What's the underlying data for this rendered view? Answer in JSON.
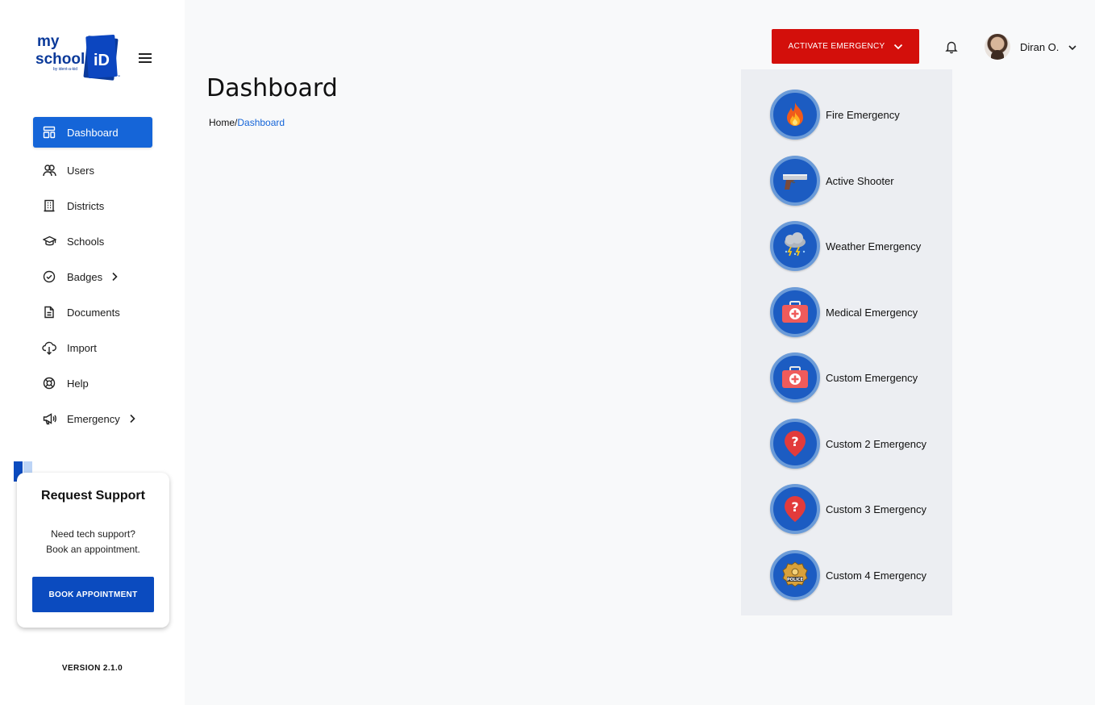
{
  "logo": {
    "line1": "my",
    "line2": "school",
    "mark": "iD",
    "tagline": "by ident-a-kid",
    "tm": "™"
  },
  "sidebar": {
    "items": [
      {
        "label": "Dashboard",
        "icon": "dashboard-icon",
        "active": true
      },
      {
        "label": "Users",
        "icon": "users-icon"
      },
      {
        "label": "Districts",
        "icon": "building-icon"
      },
      {
        "label": "Schools",
        "icon": "graduation-cap-icon"
      },
      {
        "label": "Badges",
        "icon": "check-circle-icon",
        "has_submenu": true
      },
      {
        "label": "Documents",
        "icon": "document-icon"
      },
      {
        "label": "Import",
        "icon": "cloud-download-icon"
      },
      {
        "label": "Help",
        "icon": "lifebuoy-icon"
      },
      {
        "label": "Emergency",
        "icon": "megaphone-icon",
        "has_submenu": true
      }
    ],
    "support": {
      "title": "Request Support",
      "line1": "Need tech support?",
      "line2": "Book an appointment.",
      "button": "BOOK APPOINTMENT"
    },
    "version": "VERSION 2.1.0"
  },
  "header": {
    "emergency_button": "ACTIVATE EMERGENCY",
    "user_name": "Diran O."
  },
  "main": {
    "title": "Dashboard",
    "breadcrumb": {
      "home": "Home",
      "separator": "/",
      "current": "Dashboard"
    }
  },
  "emergency_menu": [
    {
      "label": "Fire Emergency",
      "icon": "fire-icon"
    },
    {
      "label": "Active Shooter",
      "icon": "pistol-icon"
    },
    {
      "label": "Weather Emergency",
      "icon": "storm-cloud-icon"
    },
    {
      "label": "Medical Emergency",
      "icon": "first-aid-kit-icon"
    },
    {
      "label": "Custom Emergency",
      "icon": "first-aid-kit-icon"
    },
    {
      "label": "Custom 2 Emergency",
      "icon": "question-pin-icon"
    },
    {
      "label": "Custom 3 Emergency",
      "icon": "question-pin-icon"
    },
    {
      "label": "Custom 4 Emergency",
      "icon": "police-badge-icon"
    }
  ],
  "colors": {
    "primary": "#1565d8",
    "brand_dark": "#0b4bbf",
    "emergency": "#d30f0b",
    "dropdown_bg": "#eceef2"
  }
}
